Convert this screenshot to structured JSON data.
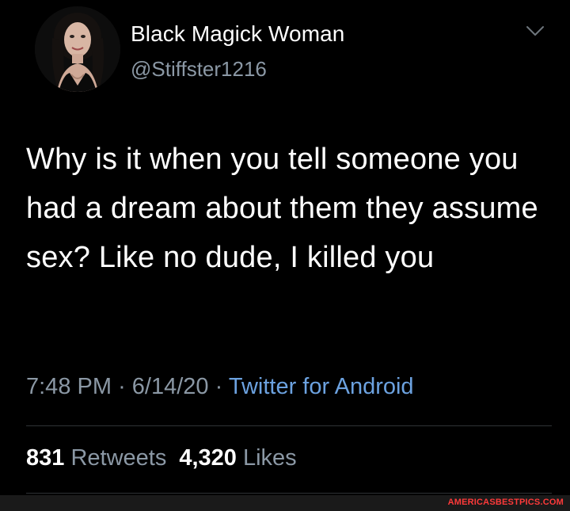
{
  "author": {
    "display_name": "Black Magick Woman",
    "handle": "@Stiffster1216",
    "avatar_icon": "profile-photo"
  },
  "tweet": {
    "text": "Why is it when you tell someone you had a dream about them they assume sex? Like no dude, I killed you",
    "time": "7:48 PM",
    "separator": "·",
    "date": "6/14/20",
    "source": "Twitter for Android"
  },
  "stats": {
    "retweets_count": "831",
    "retweets_label": "Retweets",
    "likes_count": "4,320",
    "likes_label": "Likes"
  },
  "watermark": "AMERICASBESTPICS.COM",
  "colors": {
    "background": "#000000",
    "text": "#ffffff",
    "secondary_text": "#8b98a5",
    "link": "#6ca2e0",
    "divider": "#2f3336",
    "watermark": "#ff3a3a"
  }
}
